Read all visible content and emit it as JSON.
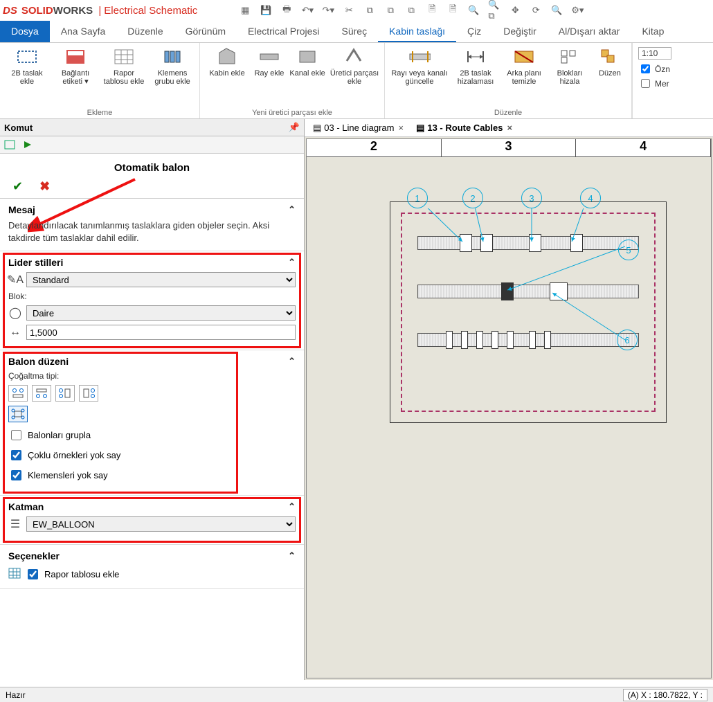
{
  "app": {
    "brand1": "SOLID",
    "brand2": "WORKS",
    "product": "Electrical Schematic"
  },
  "menu": {
    "file": "Dosya",
    "items": [
      "Ana Sayfa",
      "Düzenle",
      "Görünüm",
      "Electrical Projesi",
      "Süreç",
      "Kabin taslağı",
      "Çiz",
      "Değiştir",
      "Al/Dışarı aktar",
      "Kitap"
    ],
    "activeIndex": 5
  },
  "ribbon": {
    "g1_label": "Ekleme",
    "g2_label": "Yeni üretici parçası ekle",
    "g3_label": "Düzenle",
    "items": {
      "add_outline": "2B taslak ekle",
      "conn_label": "Bağlantı etiketi ▾",
      "report": "Rapor tablosu ekle",
      "klemens": "Klemens grubu ekle",
      "kabin": "Kabin ekle",
      "ray": "Ray ekle",
      "kanal": "Kanal ekle",
      "uretici": "Üretici parçası ekle",
      "rayguncelle": "Rayı veya kanalı güncelle",
      "hizalama": "2B taslak hizalaması",
      "arka": "Arka planı temizle",
      "blok": "Blokları hizala",
      "duzen": "Düzen"
    }
  },
  "rightopts": {
    "scale": "1:10",
    "ozn": "Özn",
    "mer": "Mer"
  },
  "leftpanel": {
    "komut": "Komut",
    "title": "Otomatik balon",
    "mesaj_h": "Mesaj",
    "mesaj_body": "Detaylandırılacak tanımlanmış taslaklara giden objeler seçin. Aksi takdirde tüm taslaklar dahil edilir.",
    "lider_h": "Lider stilleri",
    "lider_style": "Standard",
    "blok_lbl": "Blok:",
    "blok_val": "Daire",
    "size_val": "1,5000",
    "balon_h": "Balon düzeni",
    "cogaltma": "Çoğaltma tipi:",
    "chk_grupla": "Balonları grupla",
    "chk_coklu": "Çoklu örnekleri yok say",
    "chk_klemens": "Klemensleri yok say",
    "katman_h": "Katman",
    "katman_val": "EW_BALLOON",
    "secenekler_h": "Seçenekler",
    "chk_rapor": "Rapor tablosu ekle"
  },
  "tabs": {
    "t1": "03 - Line diagram",
    "t2": "13 - Route Cables"
  },
  "ruler": [
    "2",
    "3",
    "4"
  ],
  "balloons": [
    "1",
    "2",
    "3",
    "4",
    "5",
    "6"
  ],
  "status": {
    "ready": "Hazır",
    "coord": "(A) X : 180.7822, Y :"
  }
}
